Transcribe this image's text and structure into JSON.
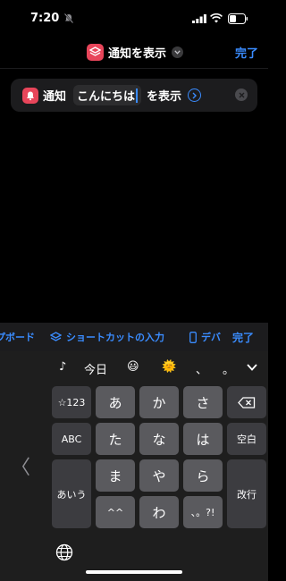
{
  "status_bar": {
    "time": "7:20",
    "icons": [
      "bell-slash-icon",
      "signal-icon",
      "wifi-icon",
      "battery-icon"
    ]
  },
  "nav": {
    "title": "通知を表示",
    "done": "完了",
    "app_icon": "shortcuts-icon",
    "accent_color": "#3a8cff",
    "app_color": "#e8455a"
  },
  "action": {
    "icon": "bell-icon",
    "label": "通知",
    "token": "こんにちは",
    "suffix": "を表示"
  },
  "accessory": {
    "clipboard": "クリップボード",
    "shortcut_input": "ショートカットの入力",
    "device_partial": "デバ",
    "done": "完了"
  },
  "keyboard": {
    "candidates": [
      "♪",
      "今日",
      "😃",
      "🌞",
      "、",
      "。"
    ],
    "rows": {
      "r1": {
        "left": "☆123",
        "keys": [
          "あ",
          "か",
          "さ"
        ]
      },
      "r2": {
        "left": "ABC",
        "keys": [
          "た",
          "な",
          "は"
        ],
        "right": "空白"
      },
      "r3": {
        "left": "あいう",
        "keys": [
          "ま",
          "や",
          "ら"
        ],
        "right": "改行"
      },
      "r4": {
        "keys": [
          "^^",
          "わ",
          "、。?!"
        ]
      }
    },
    "side_chevron": "〈",
    "key_color": "#5a5a5e",
    "func_key_color": "#3c3c40"
  }
}
